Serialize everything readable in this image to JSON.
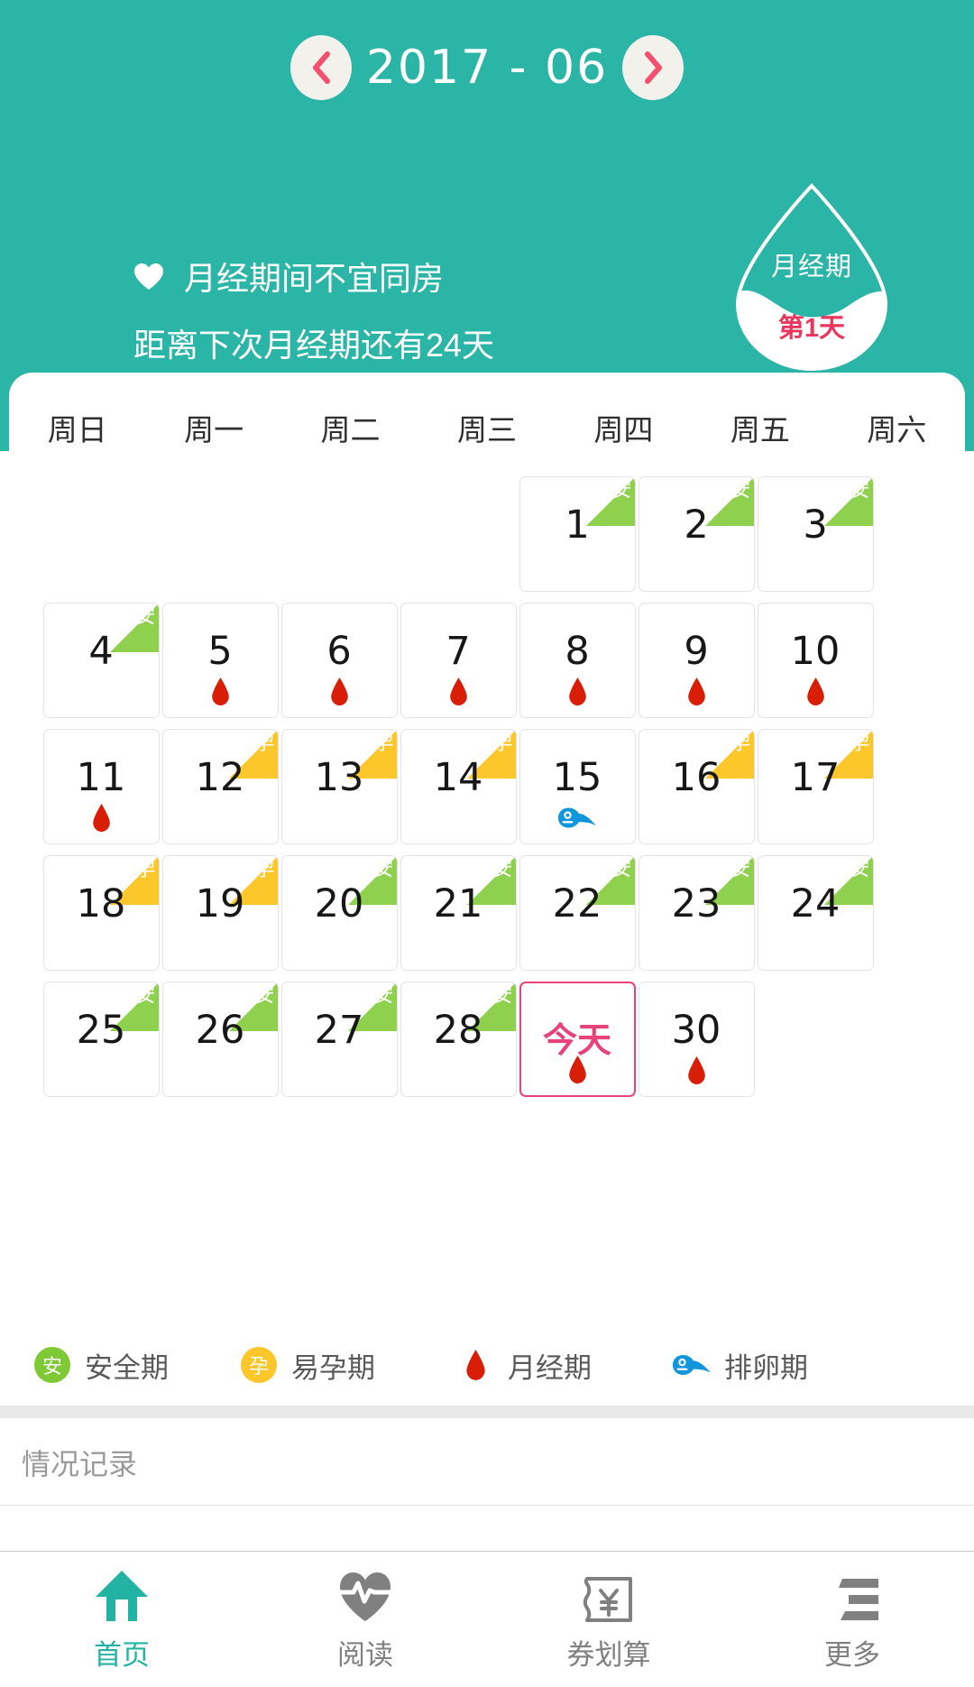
{
  "header": {
    "month_title": "2017 - 06",
    "prev_icon": "chevron-left-icon",
    "next_icon": "chevron-right-icon",
    "heart_icon": "heart-icon",
    "tip_line1": "月经期间不宜同房",
    "tip_line2": "距离下次月经期还有24天",
    "drop": {
      "label": "月经期",
      "day": "第1天",
      "label_color": "#ffffff",
      "day_color": "#e8365d"
    },
    "bg_color": "#2bb5a7"
  },
  "calendar": {
    "weekdays": [
      "周日",
      "周一",
      "周二",
      "周三",
      "周四",
      "周五",
      "周六"
    ],
    "weeks": [
      [
        {
          "num": "",
          "empty": true
        },
        {
          "num": "",
          "empty": true
        },
        {
          "num": "",
          "empty": true
        },
        {
          "num": "",
          "empty": true
        },
        {
          "num": "1",
          "corner": "安",
          "corner_type": "safe",
          "mark": ""
        },
        {
          "num": "2",
          "corner": "安",
          "corner_type": "safe",
          "mark": ""
        },
        {
          "num": "3",
          "corner": "安",
          "corner_type": "safe",
          "mark": ""
        }
      ],
      [
        {
          "num": "4",
          "corner": "安",
          "corner_type": "safe",
          "mark": ""
        },
        {
          "num": "5",
          "corner": "",
          "corner_type": "",
          "mark": "drop"
        },
        {
          "num": "6",
          "corner": "",
          "corner_type": "",
          "mark": "drop"
        },
        {
          "num": "7",
          "corner": "",
          "corner_type": "",
          "mark": "drop"
        },
        {
          "num": "8",
          "corner": "",
          "corner_type": "",
          "mark": "drop"
        },
        {
          "num": "9",
          "corner": "",
          "corner_type": "",
          "mark": "drop"
        },
        {
          "num": "10",
          "corner": "",
          "corner_type": "",
          "mark": "drop"
        }
      ],
      [
        {
          "num": "11",
          "corner": "",
          "corner_type": "",
          "mark": "drop"
        },
        {
          "num": "12",
          "corner": "孕",
          "corner_type": "fertile",
          "mark": ""
        },
        {
          "num": "13",
          "corner": "孕",
          "corner_type": "fertile",
          "mark": ""
        },
        {
          "num": "14",
          "corner": "孕",
          "corner_type": "fertile",
          "mark": ""
        },
        {
          "num": "15",
          "corner": "",
          "corner_type": "",
          "mark": "sperm"
        },
        {
          "num": "16",
          "corner": "孕",
          "corner_type": "fertile",
          "mark": ""
        },
        {
          "num": "17",
          "corner": "孕",
          "corner_type": "fertile",
          "mark": ""
        }
      ],
      [
        {
          "num": "18",
          "corner": "孕",
          "corner_type": "fertile",
          "mark": ""
        },
        {
          "num": "19",
          "corner": "孕",
          "corner_type": "fertile",
          "mark": ""
        },
        {
          "num": "20",
          "corner": "安",
          "corner_type": "safe",
          "mark": ""
        },
        {
          "num": "21",
          "corner": "安",
          "corner_type": "safe",
          "mark": ""
        },
        {
          "num": "22",
          "corner": "安",
          "corner_type": "safe",
          "mark": ""
        },
        {
          "num": "23",
          "corner": "安",
          "corner_type": "safe",
          "mark": ""
        },
        {
          "num": "24",
          "corner": "安",
          "corner_type": "safe",
          "mark": ""
        }
      ],
      [
        {
          "num": "25",
          "corner": "安",
          "corner_type": "safe",
          "mark": ""
        },
        {
          "num": "26",
          "corner": "安",
          "corner_type": "safe",
          "mark": ""
        },
        {
          "num": "27",
          "corner": "安",
          "corner_type": "safe",
          "mark": ""
        },
        {
          "num": "28",
          "corner": "安",
          "corner_type": "safe",
          "mark": ""
        },
        {
          "num": "今天",
          "corner": "",
          "corner_type": "",
          "mark": "drop",
          "today": true
        },
        {
          "num": "30",
          "corner": "",
          "corner_type": "",
          "mark": "drop"
        },
        {
          "num": "",
          "empty": true
        }
      ]
    ],
    "colors": {
      "safe": "#8fd14f",
      "fertile": "#fbc72a",
      "period": "#d81e06",
      "ovulation": "#1296db",
      "today_border": "#e8427a"
    }
  },
  "legend": [
    {
      "icon": "safe-badge-icon",
      "badge_text": "安",
      "label": "安全期"
    },
    {
      "icon": "fertile-badge-icon",
      "badge_text": "孕",
      "label": "易孕期"
    },
    {
      "icon": "blood-drop-icon",
      "badge_text": "",
      "label": "月经期"
    },
    {
      "icon": "sperm-icon",
      "badge_text": "",
      "label": "排卵期"
    }
  ],
  "record": {
    "placeholder": "情况记录"
  },
  "tabbar": {
    "items": [
      {
        "icon": "home-icon",
        "label": "首页",
        "active": true
      },
      {
        "icon": "heart-pulse-icon",
        "label": "阅读",
        "active": false
      },
      {
        "icon": "coupon-yen-icon",
        "label": "券划算",
        "active": false
      },
      {
        "icon": "more-lines-icon",
        "label": "更多",
        "active": false
      }
    ],
    "active_color": "#23b3a4",
    "inactive_color": "#808080"
  }
}
